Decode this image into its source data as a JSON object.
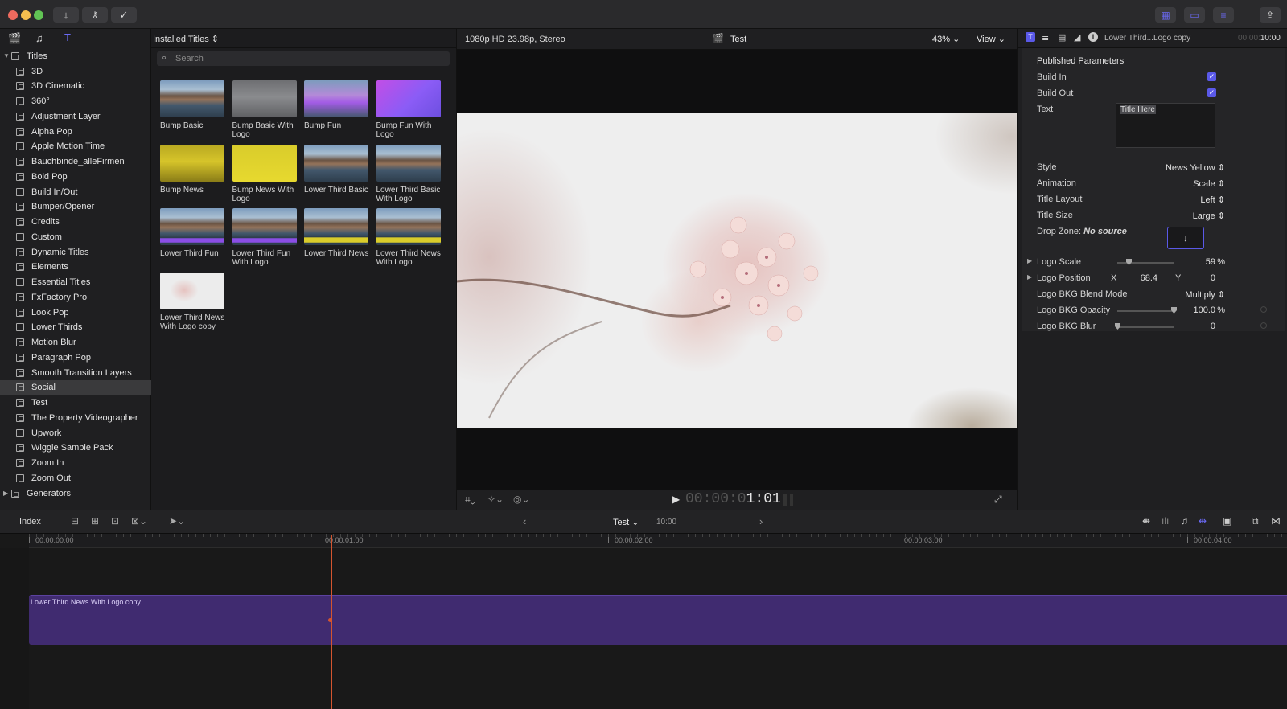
{
  "toolbar": {
    "buttons": [
      "import-icon",
      "key-icon",
      "background-tasks-icon"
    ],
    "right_buttons": [
      "browser-icon",
      "timeline-icon",
      "inspector-icon",
      "share-icon"
    ]
  },
  "sidebar": {
    "root": "Titles",
    "items": [
      "3D",
      "3D Cinematic",
      "360°",
      "Adjustment Layer",
      "Alpha Pop",
      "Apple Motion Time",
      "Bauchbinde_alleFirmen",
      "Bold Pop",
      "Build In/Out",
      "Bumper/Opener",
      "Credits",
      "Custom",
      "Dynamic Titles",
      "Elements",
      "Essential Titles",
      "FxFactory Pro",
      "Look Pop",
      "Lower Thirds",
      "Motion Blur",
      "Paragraph Pop",
      "Smooth Transition Layers",
      "Social",
      "Test",
      "The Property Videographer",
      "Upwork",
      "Wiggle Sample Pack",
      "Zoom In",
      "Zoom Out"
    ],
    "selected": "Social",
    "generators": "Generators"
  },
  "browser": {
    "header": "Installed Titles",
    "search_placeholder": "Search",
    "thumbs": [
      {
        "label": "Bump Basic",
        "style": "mountain"
      },
      {
        "label": "Bump Basic With Logo",
        "style": "gray"
      },
      {
        "label": "Bump Fun",
        "style": "fun"
      },
      {
        "label": "Bump Fun With Logo",
        "style": "purple"
      },
      {
        "label": "Bump News",
        "style": "yellow"
      },
      {
        "label": "Bump News With Logo",
        "style": "yellow-logo"
      },
      {
        "label": "Lower Third Basic",
        "style": "mountain"
      },
      {
        "label": "Lower Third Basic With Logo",
        "style": "mountain"
      },
      {
        "label": "Lower Third Fun",
        "style": "mountain-purple"
      },
      {
        "label": "Lower Third Fun With Logo",
        "style": "mountain-purple"
      },
      {
        "label": "Lower Third News",
        "style": "mountain-yellow"
      },
      {
        "label": "Lower Third News With Logo",
        "style": "mountain-yellow"
      },
      {
        "label": "Lower Third News With Logo copy",
        "style": "blossom"
      }
    ]
  },
  "viewer": {
    "format": "1080p HD 23.98p, Stereo",
    "project": "Test",
    "zoom": "43%",
    "view_label": "View",
    "timecode_dim": "00:00:0",
    "timecode_bright": "1:01"
  },
  "inspector": {
    "title": "Lower Third...Logo copy",
    "duration_dim": "00:00:",
    "duration": "10:00",
    "section": "Published Parameters",
    "build_in": "Build In",
    "build_out": "Build Out",
    "text_label": "Text",
    "text_value": "Title Here",
    "style_label": "Style",
    "style_value": "News Yellow",
    "animation_label": "Animation",
    "animation_value": "Scale",
    "layout_label": "Title Layout",
    "layout_value": "Left",
    "size_label": "Title Size",
    "size_value": "Large",
    "dropzone_label": "Drop Zone:",
    "dropzone_value": "No source",
    "logo_scale_label": "Logo Scale",
    "logo_scale_value": "59",
    "logo_scale_fraction": 0.2,
    "percent": "%",
    "logo_position_label": "Logo Position",
    "x_label": "X",
    "x_value": "68.4",
    "y_label": "Y",
    "y_value": "0",
    "blend_label": "Logo BKG Blend Mode",
    "blend_value": "Multiply",
    "opacity_label": "Logo BKG Opacity",
    "opacity_value": "100.0",
    "opacity_fraction": 1.0,
    "blur_label": "Logo BKG Blur",
    "blur_value": "0",
    "blur_fraction": 0.0
  },
  "timeline": {
    "index_label": "Index",
    "project": "Test",
    "duration": "10:00",
    "ruler": [
      "00:00:00:00",
      "00:00:01:00",
      "00:00:02:00",
      "00:00:03:00",
      "00:00:04:00"
    ],
    "clip_label": "Lower Third News With Logo copy"
  },
  "colors": {
    "accent": "#5a59e8",
    "clip": "#402b70",
    "playhead": "#d4552f"
  }
}
